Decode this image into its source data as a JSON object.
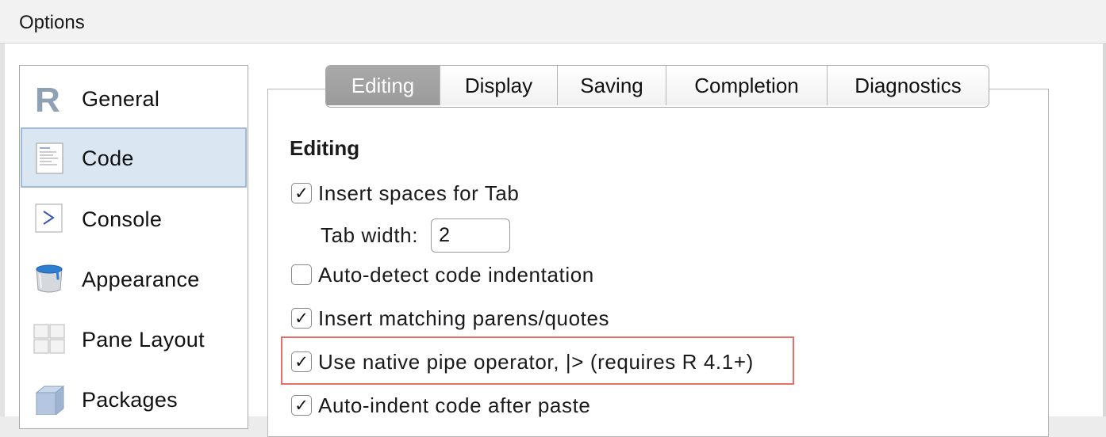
{
  "window": {
    "title": "Options"
  },
  "sidebar": {
    "items": [
      {
        "label": "General",
        "icon": "r-logo-icon",
        "selected": false
      },
      {
        "label": "Code",
        "icon": "code-document-icon",
        "selected": true
      },
      {
        "label": "Console",
        "icon": "console-prompt-icon",
        "selected": false
      },
      {
        "label": "Appearance",
        "icon": "paint-bucket-icon",
        "selected": false
      },
      {
        "label": "Pane Layout",
        "icon": "pane-grid-icon",
        "selected": false
      },
      {
        "label": "Packages",
        "icon": "package-box-icon",
        "selected": false
      }
    ]
  },
  "tabs": [
    {
      "label": "Editing",
      "active": true
    },
    {
      "label": "Display",
      "active": false
    },
    {
      "label": "Saving",
      "active": false
    },
    {
      "label": "Completion",
      "active": false
    },
    {
      "label": "Diagnostics",
      "active": false
    }
  ],
  "editing": {
    "section_title": "Editing",
    "insert_spaces": {
      "label": "Insert spaces for Tab",
      "checked": true
    },
    "tab_width": {
      "label": "Tab width:",
      "value": "2"
    },
    "auto_detect": {
      "label": "Auto-detect code indentation",
      "checked": false
    },
    "matching_parens": {
      "label": "Insert matching parens/quotes",
      "checked": true
    },
    "native_pipe": {
      "label": "Use native pipe operator, |> (requires R 4.1+)",
      "checked": true
    },
    "auto_indent": {
      "label": "Auto-indent code after paste",
      "checked": true
    }
  },
  "colors": {
    "selected_bg": "#dbe6f3",
    "active_tab_bg": "#a3a3a3",
    "highlight_border": "#e3716a"
  },
  "checkmark": "✓"
}
